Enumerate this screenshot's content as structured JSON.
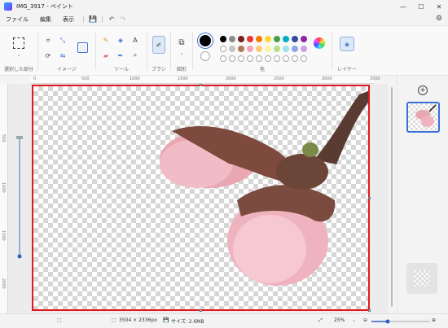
{
  "window": {
    "title": "IMG_3917 - ペイント",
    "minimize": "—",
    "maximize": "☐",
    "close": "✕"
  },
  "menu": {
    "file": "ファイル",
    "edit": "編集",
    "view": "表示"
  },
  "ribbon": {
    "selection_label": "選択した部分",
    "image_label": "イメージ",
    "tools_label": "ツール",
    "brush_label": "ブラシ",
    "shapes_label": "図形",
    "colors_label": "色",
    "layers_label": "レイヤー"
  },
  "palette_top": [
    "#000000",
    "#8a8a8a",
    "#7a1f1f",
    "#e53935",
    "#f57c00",
    "#fdd835",
    "#43a047",
    "#00acc1",
    "#3949ab",
    "#8e24aa"
  ],
  "palette_bottom": [
    "#ffffff",
    "#c4c4c4",
    "#b07a5a",
    "#f4a6b7",
    "#ffca7a",
    "#fff3a0",
    "#b5e08a",
    "#9fe0ea",
    "#90a4e8",
    "#c8a2e0"
  ],
  "ruler_h": [
    "0",
    "500",
    "1000",
    "1500",
    "2000",
    "2500",
    "3000",
    "3500"
  ],
  "ruler_v": [
    "500",
    "1000",
    "1500",
    "2000"
  ],
  "status": {
    "dimensions": "3504 × 2336px",
    "size": "サイズ: 2.6MB",
    "zoom": "25%"
  },
  "layers_panel": {
    "add": "+"
  }
}
